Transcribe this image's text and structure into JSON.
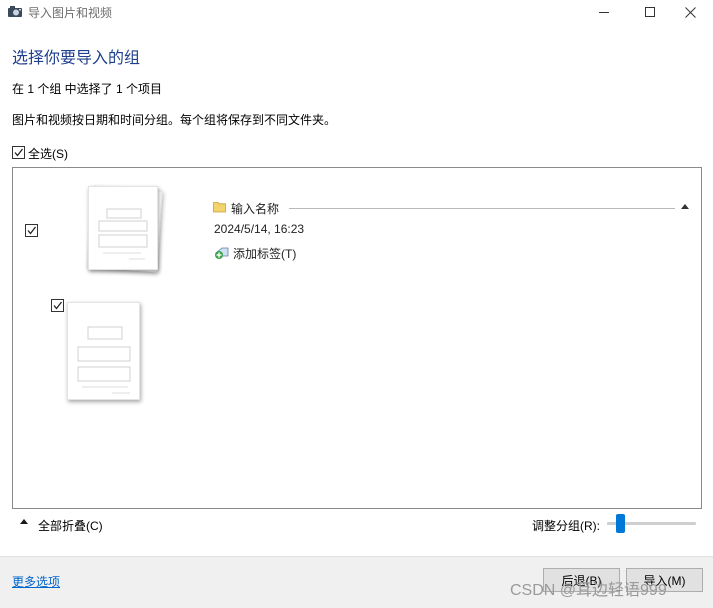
{
  "window": {
    "title": "导入图片和视频",
    "controls": {
      "minimize": "—",
      "maximize": "☐",
      "close": "✕"
    }
  },
  "header": {
    "heading": "选择你要导入的组",
    "summary": "在 1 个组 中选择了 1 个项目",
    "description": "图片和视频按日期和时间分组。每个组将保存到不同文件夹。",
    "select_all_label": "全选(S)",
    "select_all_checked": true
  },
  "group": {
    "name_placeholder": "输入名称",
    "date": "2024/5/14, 16:23",
    "add_tag_label": "添加标签(T)",
    "checked": true,
    "items": [
      {
        "checked": true
      }
    ]
  },
  "bottom_bar": {
    "collapse_all_label": "全部折叠(C)",
    "adjust_groups_label": "调整分组(R):",
    "adjust_groups_value": 0.1
  },
  "footer": {
    "more_options_label": "更多选项",
    "back_button_label": "后退(B)",
    "import_button_label": "导入(M)",
    "watermark": "CSDN @耳边轻语999"
  },
  "colors": {
    "heading": "#1f3f8c",
    "link": "#0066cc",
    "slider_accent": "#0078d7"
  },
  "icons": [
    "camera-icon",
    "folder-icon",
    "tag-add-icon",
    "checkmark-icon",
    "chevron-up-icon"
  ]
}
